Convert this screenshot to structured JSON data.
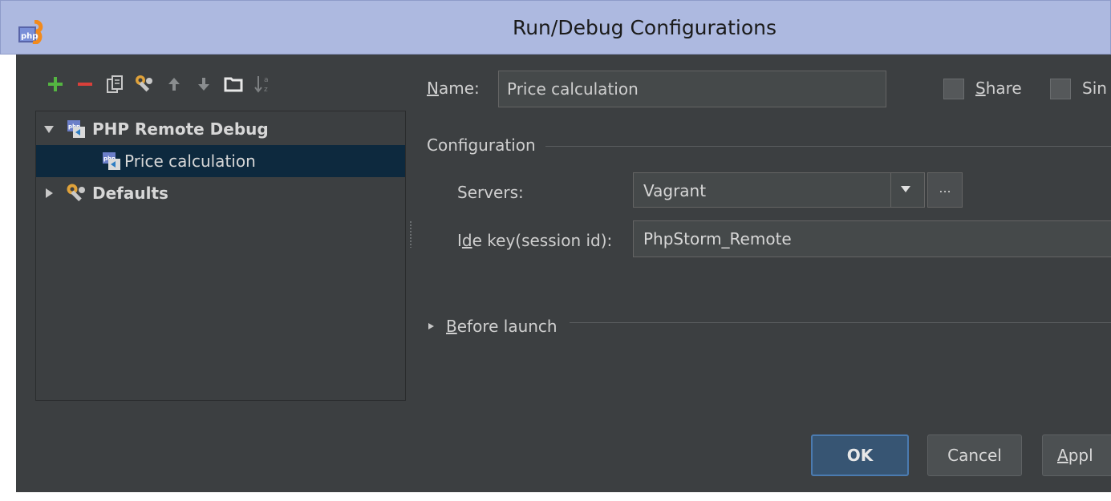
{
  "window": {
    "title": "Run/Debug Configurations"
  },
  "toolbar": {
    "icons": [
      "add-icon",
      "remove-icon",
      "copy-icon",
      "wrench-icon",
      "move-up-icon",
      "move-down-icon",
      "folder-icon",
      "sort-icon"
    ]
  },
  "tree": {
    "items": [
      {
        "label": "PHP Remote Debug",
        "expanded": true,
        "icon": "php-remote-debug-icon"
      },
      {
        "label": "Price calculation",
        "selected": true,
        "icon": "php-remote-debug-icon"
      },
      {
        "label": "Defaults",
        "expanded": false,
        "icon": "defaults-icon"
      }
    ]
  },
  "form": {
    "name_label": "Name:",
    "name_value": "Price calculation",
    "share_label": "Share",
    "single_label": "Sin",
    "configuration_title": "Configuration",
    "servers_label": "Servers:",
    "servers_value": "Vagrant",
    "ellipsis_label": "...",
    "ide_key_label": "Ide key(session id):",
    "ide_key_value": "PhpStorm_Remote",
    "before_launch_label": "Before launch"
  },
  "buttons": {
    "ok": "OK",
    "cancel": "Cancel",
    "apply": "Appl"
  },
  "colors": {
    "titlebar": "#adb9e0",
    "panel": "#3c3f41",
    "selection": "#0d293e",
    "add_green": "#54b541",
    "remove_red": "#d9403a"
  }
}
